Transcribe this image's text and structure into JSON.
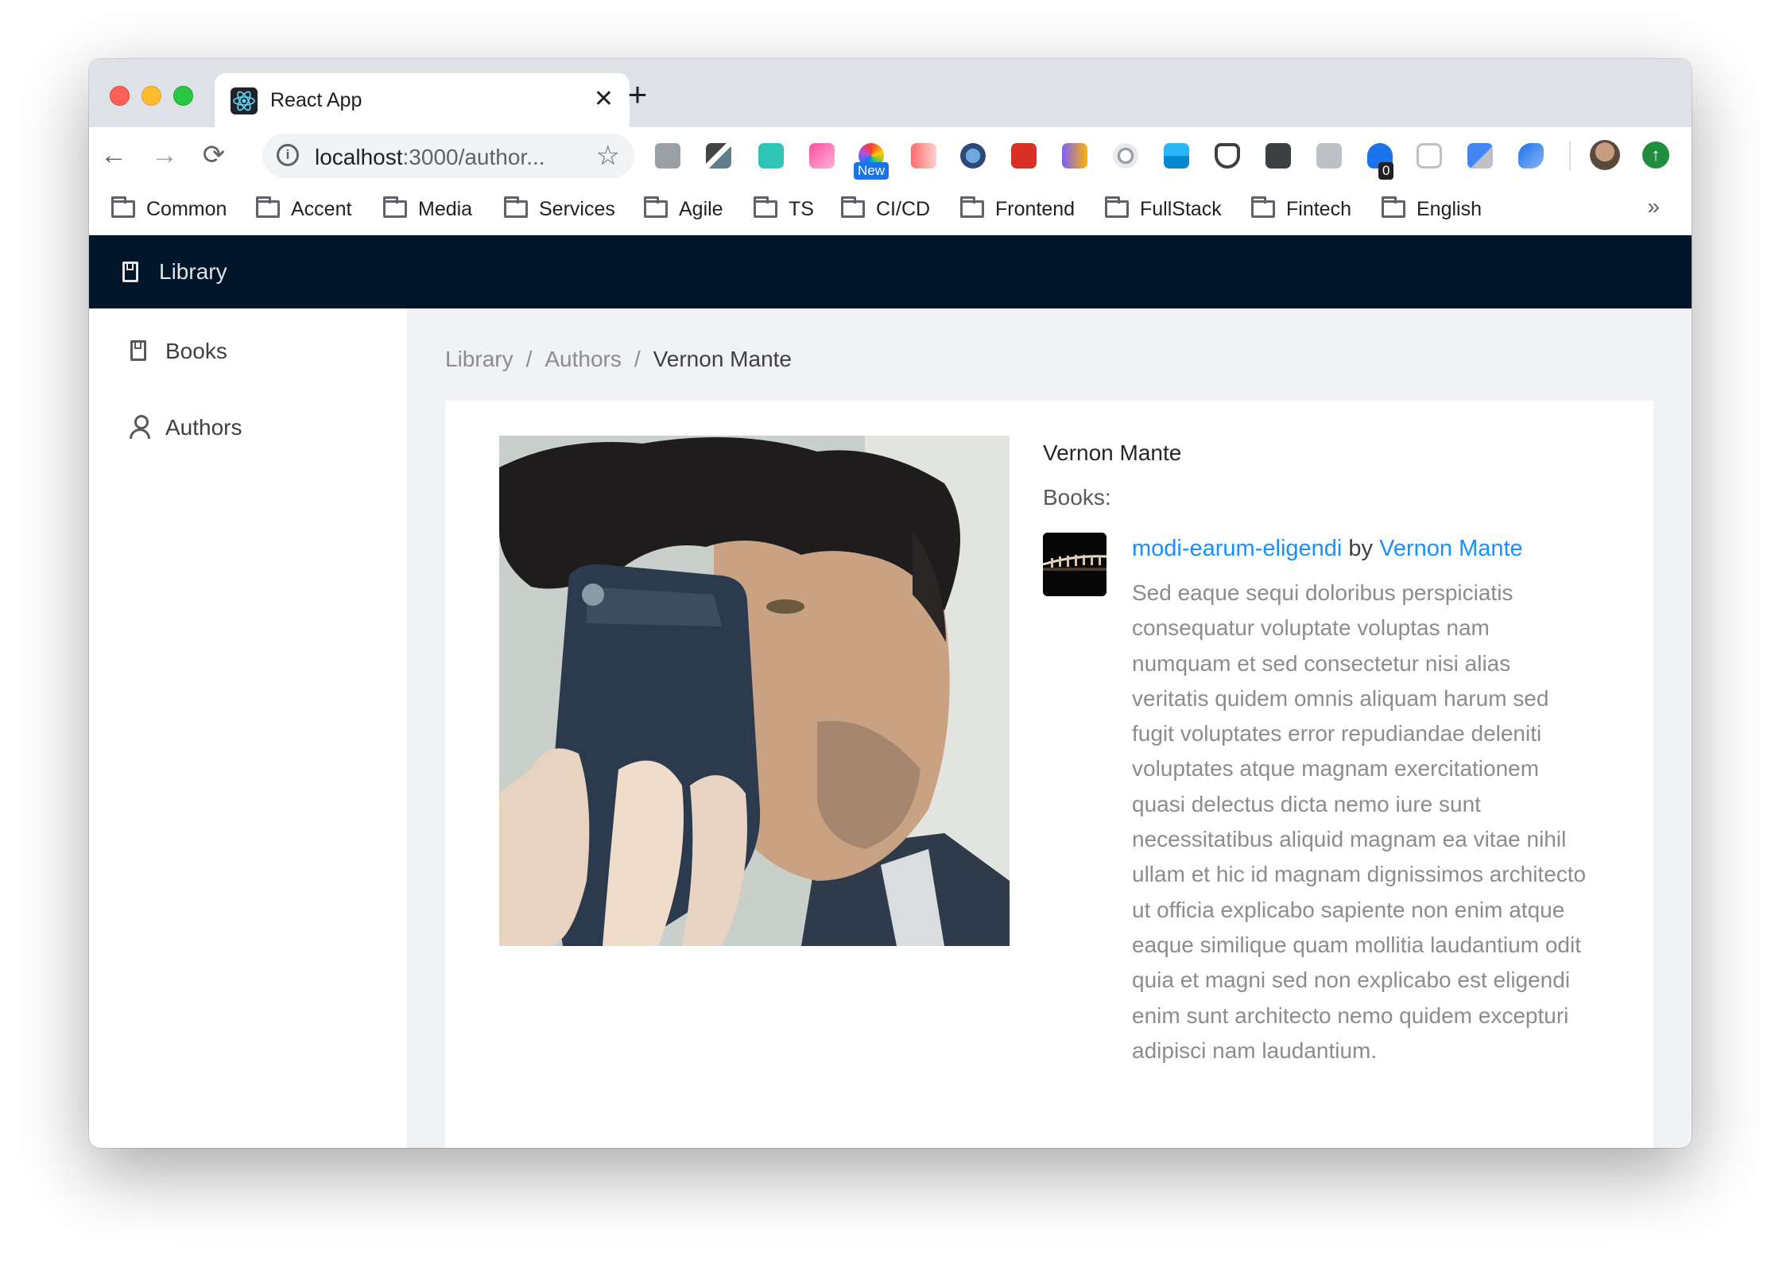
{
  "browser": {
    "tab_title": "React App",
    "tab_close": "✕",
    "new_tab": "+",
    "url_host": "localhost",
    "url_rest": ":3000/author...",
    "back": "←",
    "forward": "→",
    "reload": "⟳",
    "star": "☆",
    "extension_badge_new": "New",
    "extension_badge_count": "0",
    "bookmarks": [
      "Common",
      "Accent",
      "Media",
      "Services",
      "Agile",
      "TS",
      "CI/CD",
      "Frontend",
      "FullStack",
      "Fintech",
      "English"
    ],
    "bookmarks_more": "»"
  },
  "app": {
    "header_title": "Library",
    "sidebar": [
      {
        "label": "Books",
        "icon": "book-icon"
      },
      {
        "label": "Authors",
        "icon": "user-icon"
      }
    ],
    "breadcrumb": [
      "Library",
      "Authors",
      "Vernon Mante"
    ],
    "breadcrumb_separator": "/",
    "author": {
      "name": "Vernon Mante",
      "books_label": "Books:",
      "books": [
        {
          "title": "modi-earum-eligendi",
          "by": "by",
          "author": "Vernon Mante",
          "description": "Sed eaque sequi doloribus perspiciatis consequatur voluptate voluptas nam numquam et sed consectetur nisi alias veritatis quidem omnis aliquam harum sed fugit voluptates error repudiandae deleniti voluptates atque magnam exercitationem quasi delectus dicta nemo iure sunt necessitatibus aliquid magnam ea vitae nihil ullam et hic id magnam dignissimos architecto ut officia explicabo sapiente non enim atque eaque similique quam mollitia laudantium odit quia et magni sed non explicabo est eligendi enim sunt architecto nemo quidem excepturi adipisci nam laudantium."
        }
      ]
    }
  },
  "colors": {
    "header_bg": "#001529",
    "content_bg": "#f0f2f5",
    "link": "#1890ff"
  }
}
